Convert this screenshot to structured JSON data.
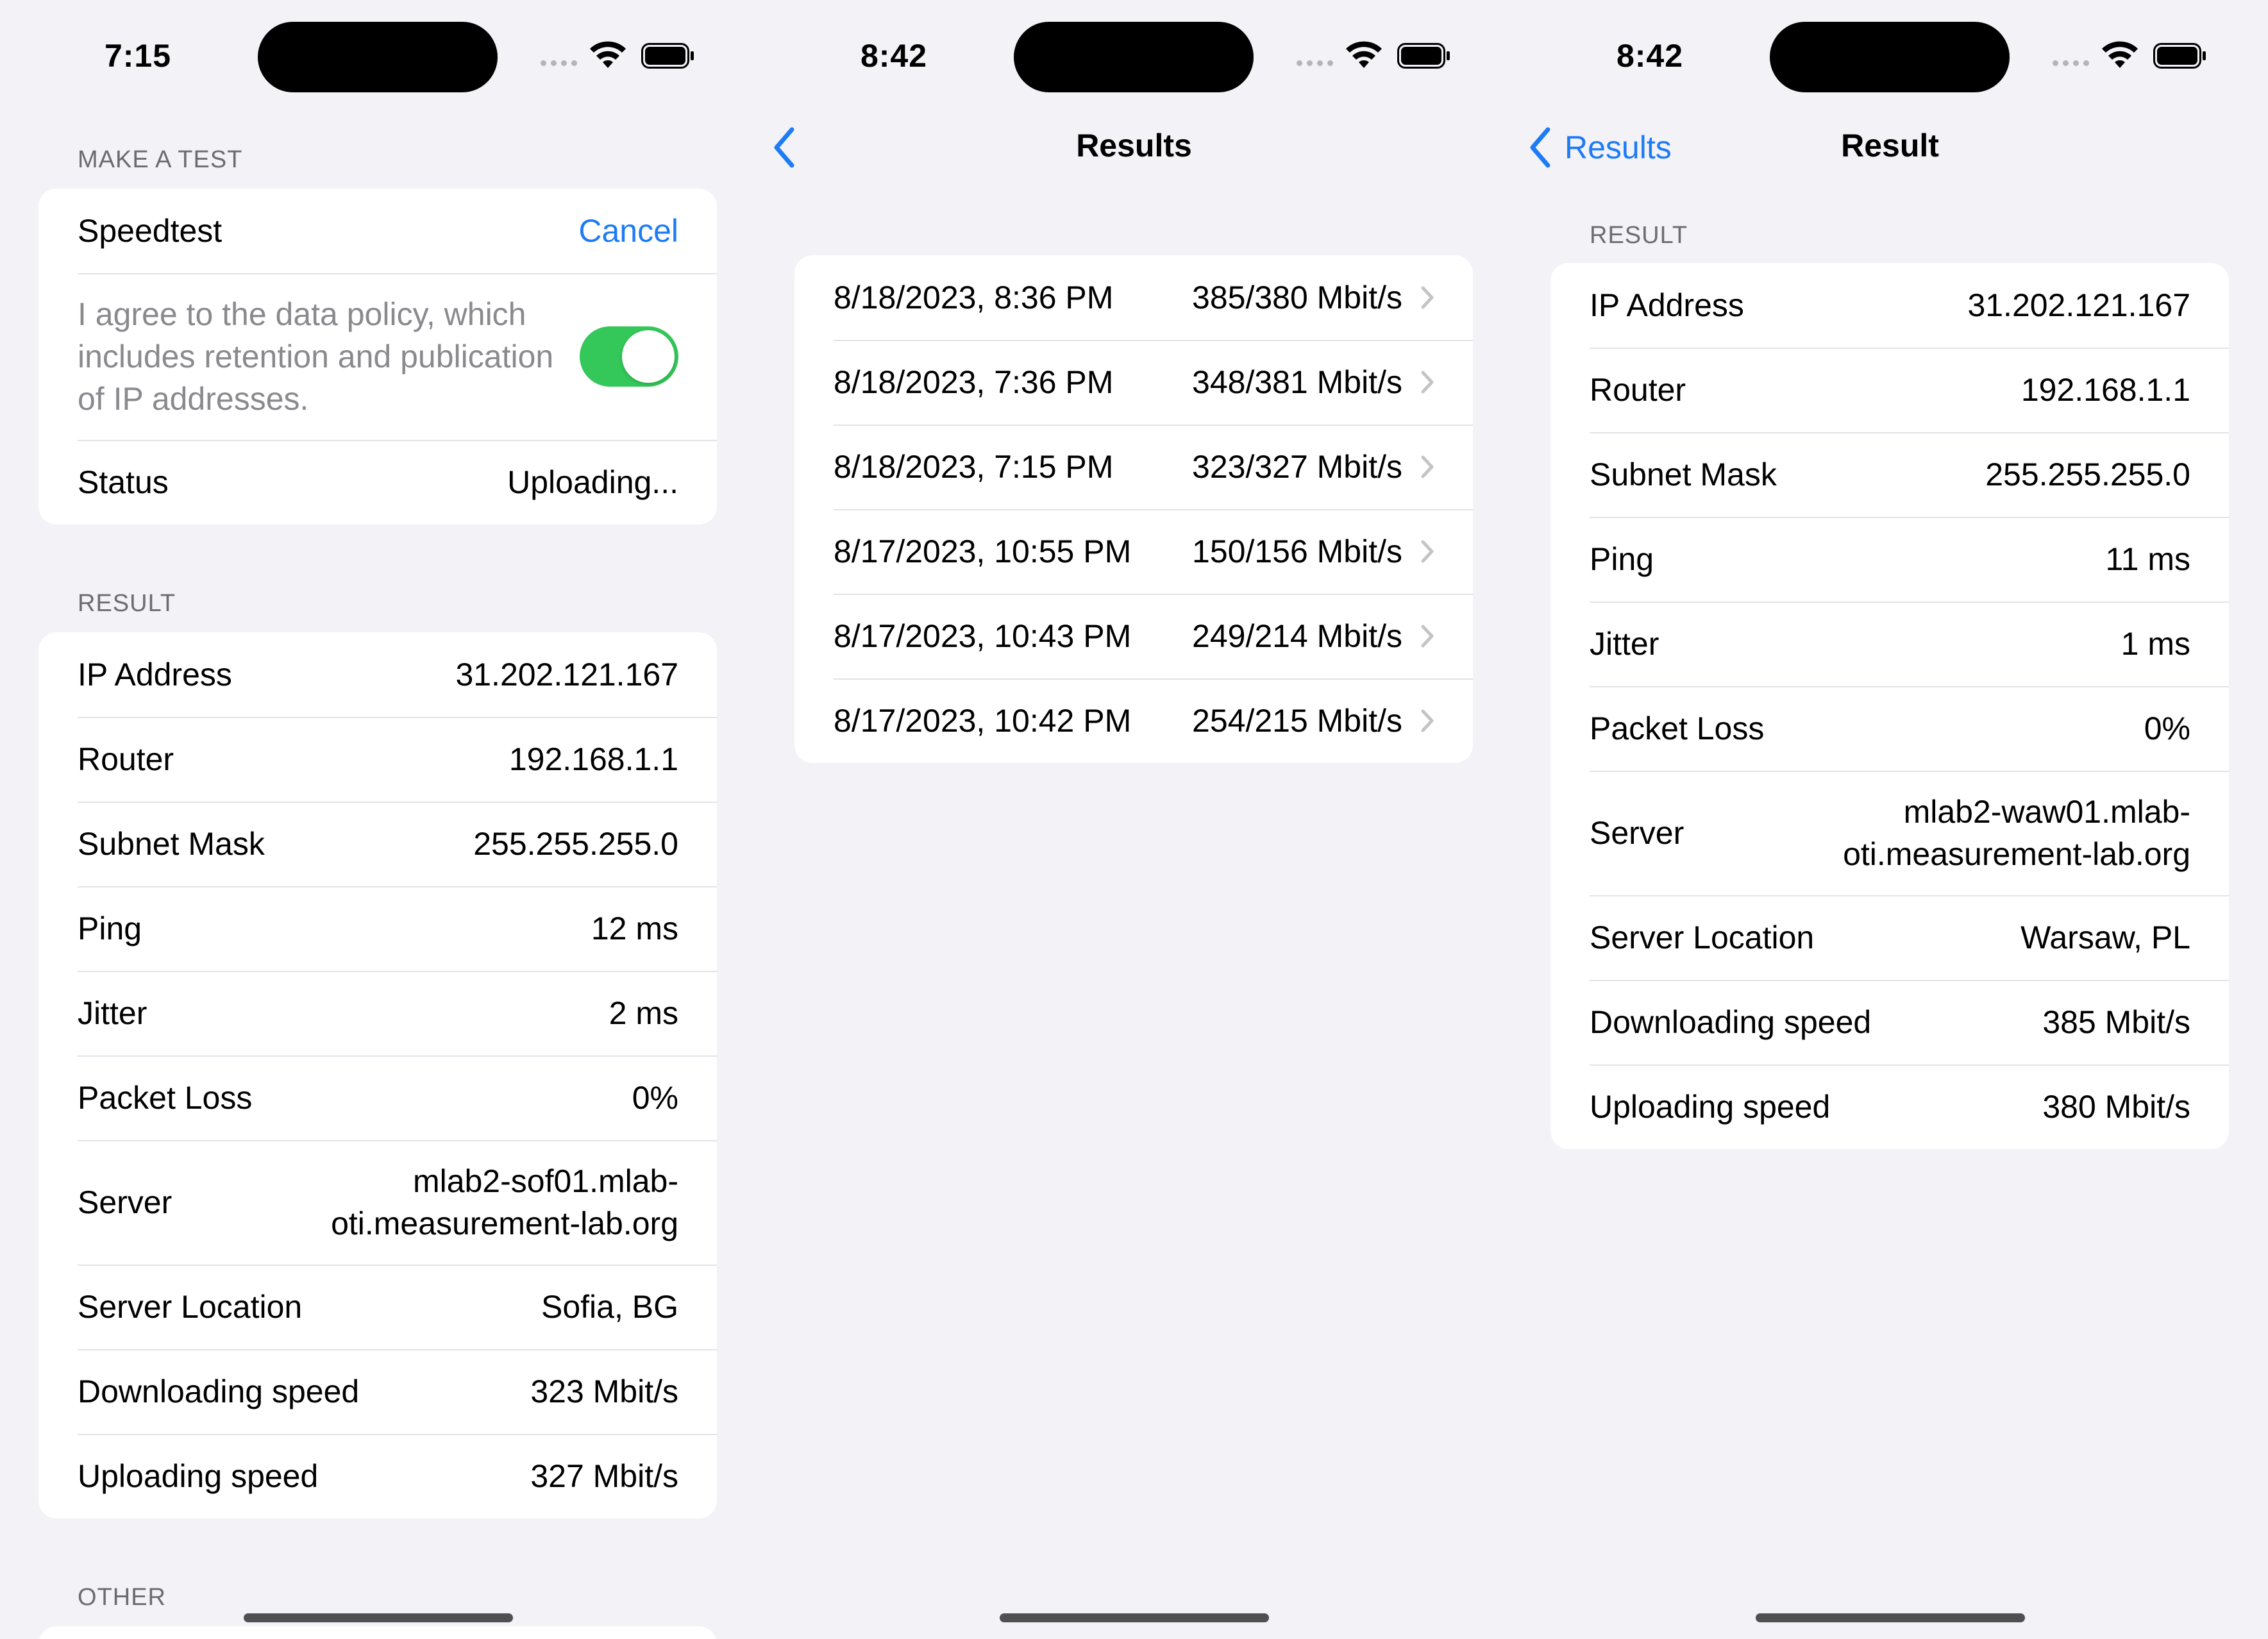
{
  "screen1": {
    "status_time": "7:15",
    "make_test_header": "MAKE A TEST",
    "speedtest_label": "Speedtest",
    "cancel_label": "Cancel",
    "consent_text": "I agree to the data policy, which includes retention and publication of IP addresses.",
    "consent_toggle_on": true,
    "status_label": "Status",
    "status_value": "Uploading...",
    "result_header": "RESULT",
    "result_rows": [
      {
        "label": "IP Address",
        "value": "31.202.121.167"
      },
      {
        "label": "Router",
        "value": "192.168.1.1"
      },
      {
        "label": "Subnet Mask",
        "value": "255.255.255.0"
      },
      {
        "label": "Ping",
        "value": "12 ms"
      },
      {
        "label": "Jitter",
        "value": "2 ms"
      },
      {
        "label": "Packet Loss",
        "value": "0%"
      },
      {
        "label": "Server",
        "value_line1": "mlab2-sof01.mlab-",
        "value_line2": "oti.measurement-lab.org"
      },
      {
        "label": "Server Location",
        "value": "Sofia, BG"
      },
      {
        "label": "Downloading speed",
        "value": "323 Mbit/s"
      },
      {
        "label": "Uploading speed",
        "value": "327 Mbit/s"
      }
    ],
    "other_header": "OTHER"
  },
  "screen2": {
    "status_time": "8:42",
    "nav_title": "Results",
    "results": [
      {
        "date": "8/18/2023, 8:36 PM",
        "speed": "385/380 Mbit/s"
      },
      {
        "date": "8/18/2023, 7:36 PM",
        "speed": "348/381 Mbit/s"
      },
      {
        "date": "8/18/2023, 7:15 PM",
        "speed": "323/327 Mbit/s"
      },
      {
        "date": "8/17/2023, 10:55 PM",
        "speed": "150/156 Mbit/s"
      },
      {
        "date": "8/17/2023, 10:43 PM",
        "speed": "249/214 Mbit/s"
      },
      {
        "date": "8/17/2023, 10:42 PM",
        "speed": "254/215 Mbit/s"
      }
    ]
  },
  "screen3": {
    "status_time": "8:42",
    "back_label": "Results",
    "nav_title": "Result",
    "result_header": "RESULT",
    "result_rows": [
      {
        "label": "IP Address",
        "value": "31.202.121.167"
      },
      {
        "label": "Router",
        "value": "192.168.1.1"
      },
      {
        "label": "Subnet Mask",
        "value": "255.255.255.0"
      },
      {
        "label": "Ping",
        "value": "11 ms"
      },
      {
        "label": "Jitter",
        "value": "1 ms"
      },
      {
        "label": "Packet Loss",
        "value": "0%"
      },
      {
        "label": "Server",
        "value_line1": "mlab2-waw01.mlab-",
        "value_line2": "oti.measurement-lab.org"
      },
      {
        "label": "Server Location",
        "value": "Warsaw, PL"
      },
      {
        "label": "Downloading speed",
        "value": "385 Mbit/s"
      },
      {
        "label": "Uploading speed",
        "value": "380 Mbit/s"
      }
    ]
  },
  "icons": {
    "wifi": "wifi-icon",
    "battery": "battery-icon",
    "back_chevron": "chevron-left-icon",
    "row_chevron": "chevron-right-icon"
  },
  "colors": {
    "background": "#F2F2F7",
    "accent": "#1E7BF6",
    "toggle_on": "#34C759",
    "secondary_text": "#6C6C70"
  }
}
